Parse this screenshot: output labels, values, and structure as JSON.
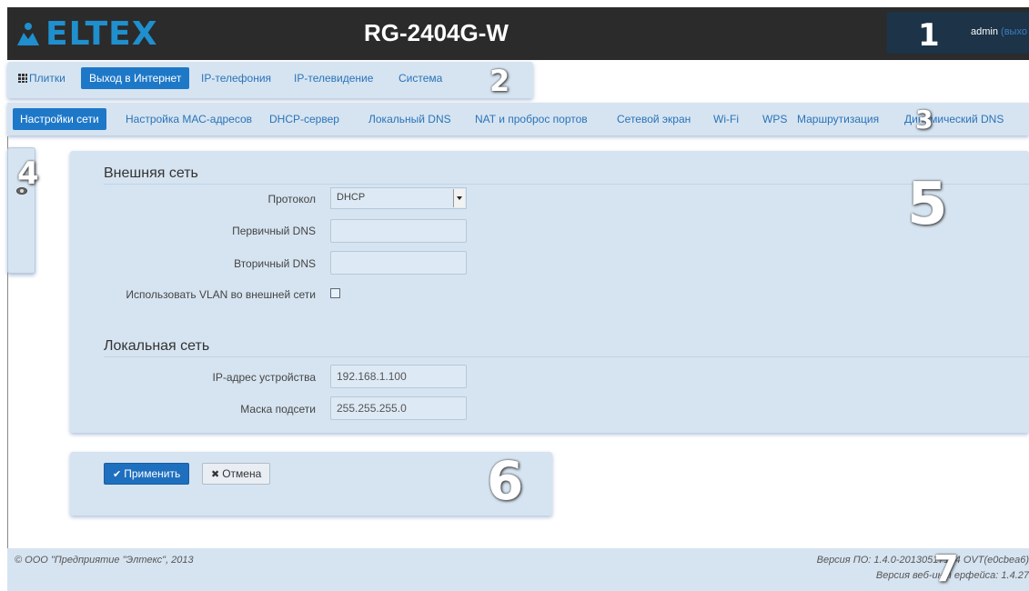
{
  "header": {
    "logo_text": "ELTEX",
    "title": "RG-2404G-W",
    "user": "admin",
    "logout": "(выхо"
  },
  "menu1": {
    "tiles": "Плитки",
    "items": [
      "Выход в Интернет",
      "IP-телефония",
      "IP-телевидение",
      "Система"
    ]
  },
  "menu2": {
    "items": [
      "Настройки сети",
      "Настройка МАС-адресов",
      "DHCP-сервер",
      "Локальный DNS",
      "NAT и проброс портов",
      "Сетевой экран",
      "Wi-Fi",
      "WPS",
      "Маршрутизация",
      "Динамический DNS"
    ]
  },
  "callouts": [
    "1",
    "2",
    "3",
    "4",
    "5",
    "6",
    "7"
  ],
  "wan": {
    "title": "Внешняя сеть",
    "protocol_label": "Протокол",
    "protocol_value": "DHCP",
    "dns1_label": "Первичный DNS",
    "dns1_value": "",
    "dns2_label": "Вторичный DNS",
    "dns2_value": "",
    "vlan_label": "Использовать VLAN во внешней сети",
    "vlan_checked": false
  },
  "lan": {
    "title": "Локальная сеть",
    "ip_label": "IP-адрес устройства",
    "ip_value": "192.168.1.100",
    "mask_label": "Маска подсети",
    "mask_value": "255.255.255.0"
  },
  "buttons": {
    "apply": "Применить",
    "cancel": "Отмена"
  },
  "footer": {
    "copyright": "© ООО \"Предприятие \"Элтекс\", 2013",
    "fw_version": "Версия ПО: 1.4.0-20130517174     OVT(e0cbea6)",
    "web_version": "Версия веб-инт    ерфейса: 1.4.27"
  },
  "colors": {
    "header_bg": "#2b2b2b",
    "accent": "#1e78c8",
    "panel_bg": "#d6e4f1",
    "logo": "#1f8fce"
  }
}
